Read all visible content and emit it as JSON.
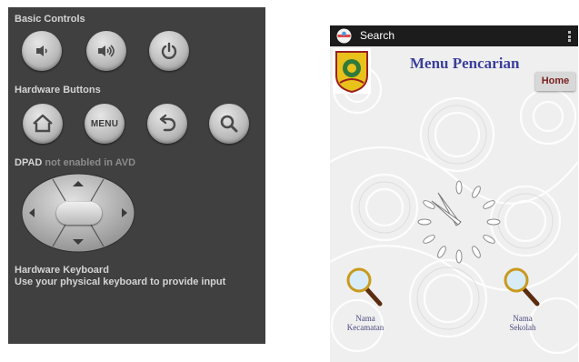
{
  "emulator_panel": {
    "basic_controls_title": "Basic Controls",
    "basic_controls": [
      {
        "name": "volume-down-icon"
      },
      {
        "name": "volume-up-icon"
      },
      {
        "name": "power-icon"
      }
    ],
    "hardware_buttons_title": "Hardware Buttons",
    "hardware_buttons": [
      {
        "name": "home-icon"
      },
      {
        "label": "MENU"
      },
      {
        "name": "back-icon"
      },
      {
        "name": "search-icon"
      }
    ],
    "dpad_title_bold": "DPAD",
    "dpad_title_rest": " not enabled in AVD",
    "keyboard_title": "Hardware Keyboard",
    "keyboard_hint": "Use your physical keyboard to provide input"
  },
  "phone": {
    "action_bar": {
      "title": "Search",
      "icon": "app-globe-icon",
      "overflow_icon": "overflow-menu-icon"
    },
    "logo": "school-emblem-logo",
    "menu_title": "Menu Pencarian",
    "home_button": "Home",
    "search_options": [
      {
        "label_line1": "Nama",
        "label_line2": "Kecamatan",
        "icon": "magnifier-icon"
      },
      {
        "label_line1": "Nama",
        "label_line2": "Sekolah",
        "icon": "magnifier-icon"
      }
    ],
    "loading_indicator": "loading-spinner-icon"
  },
  "colors": {
    "panel_bg": "#404040",
    "action_bar_bg": "#1c1c1c",
    "title_blue": "#3b3f9c",
    "home_text": "#7a1f1f"
  }
}
